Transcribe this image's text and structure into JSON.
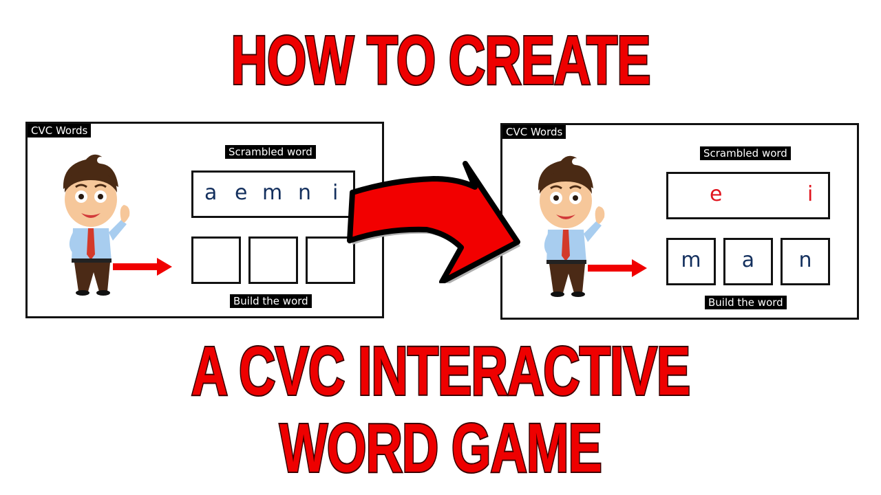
{
  "title": {
    "line1": "HOW TO CREATE",
    "line2": "A CVC INTERACTIVE",
    "line3": "WORD GAME"
  },
  "colors": {
    "title_fill": "#ee0000",
    "title_stroke": "#3a0000",
    "letter_blue": "#14305e",
    "letter_red": "#e0141e"
  },
  "slide_before": {
    "corner_label": "CVC Words",
    "scrambled_label": "Scrambled word",
    "scrambled_letters": [
      "a",
      "e",
      "m",
      "n",
      "i"
    ],
    "build_label": "Build the word",
    "build_letters": [
      "",
      "",
      ""
    ]
  },
  "slide_after": {
    "corner_label": "CVC Words",
    "scrambled_label": "Scrambled word",
    "scrambled_letters": [
      "",
      "e",
      "",
      "",
      "i"
    ],
    "build_label": "Build the word",
    "build_letters": [
      "m",
      "a",
      "n"
    ]
  },
  "icons": {
    "character": "waving-man-illustration",
    "small_arrow": "right-arrow-icon",
    "big_arrow": "curved-right-arrow-icon"
  }
}
